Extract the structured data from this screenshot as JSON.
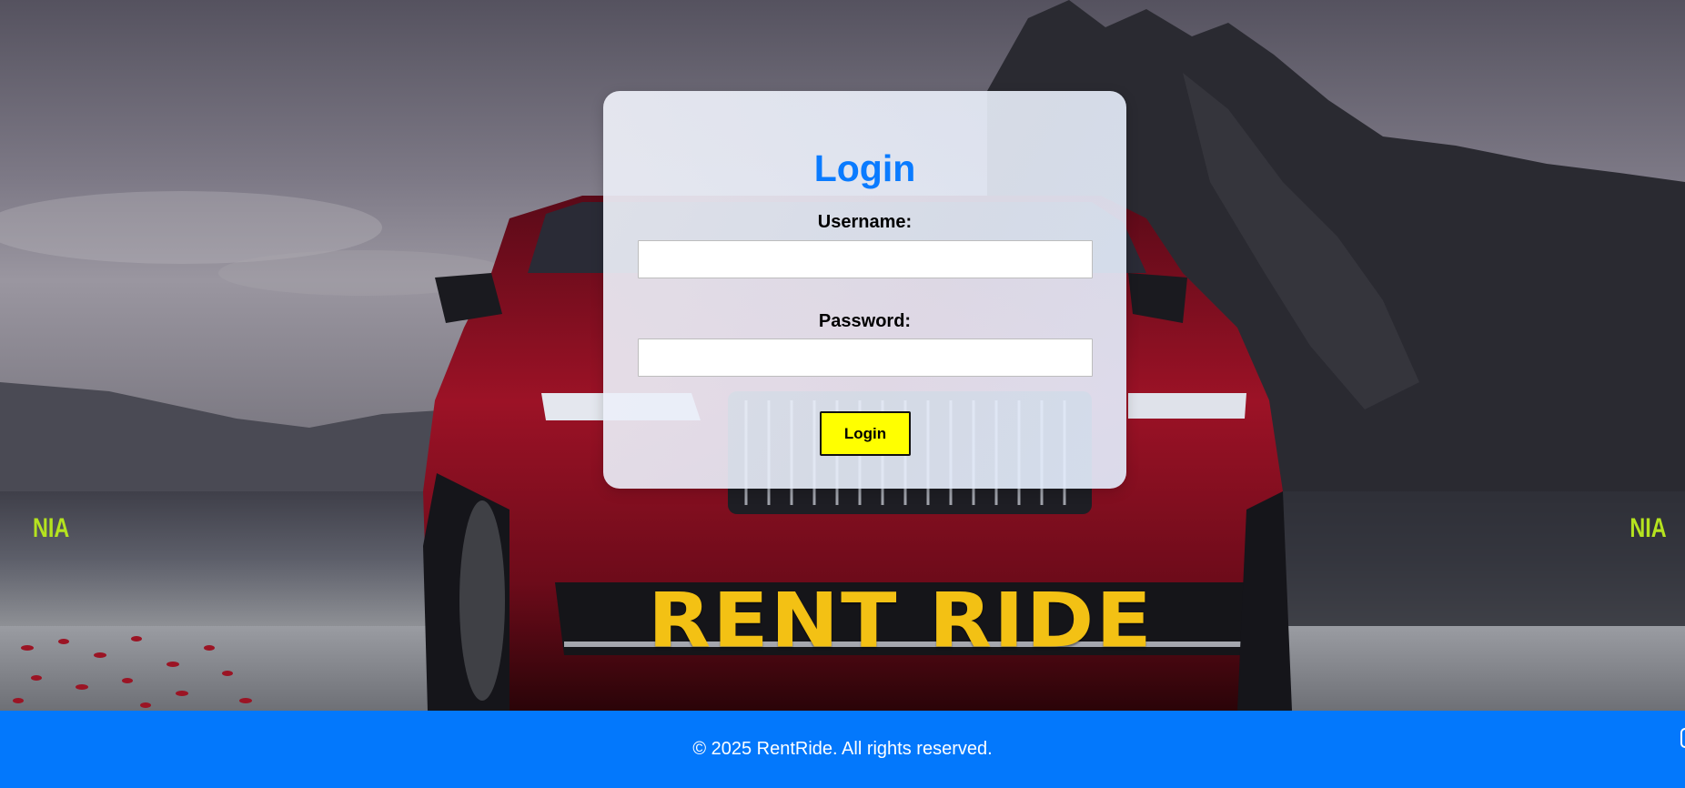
{
  "hero": {
    "brand_side_left": "NIA",
    "brand_side_right": "NIA",
    "brand_main": "RENT RIDE"
  },
  "login": {
    "title": "Login",
    "username_label": "Username:",
    "username_value": "",
    "password_label": "Password:",
    "password_value": "",
    "submit_label": "Login"
  },
  "footer": {
    "text": "© 2025 RentRide. All rights reserved."
  },
  "colors": {
    "accent_blue": "#0378fc",
    "title_blue": "#0a7bff",
    "button_yellow": "#ffff00",
    "brand_yellow": "#f3c114",
    "brand_green": "#b5e31f",
    "car_red": "#8a0f22"
  }
}
